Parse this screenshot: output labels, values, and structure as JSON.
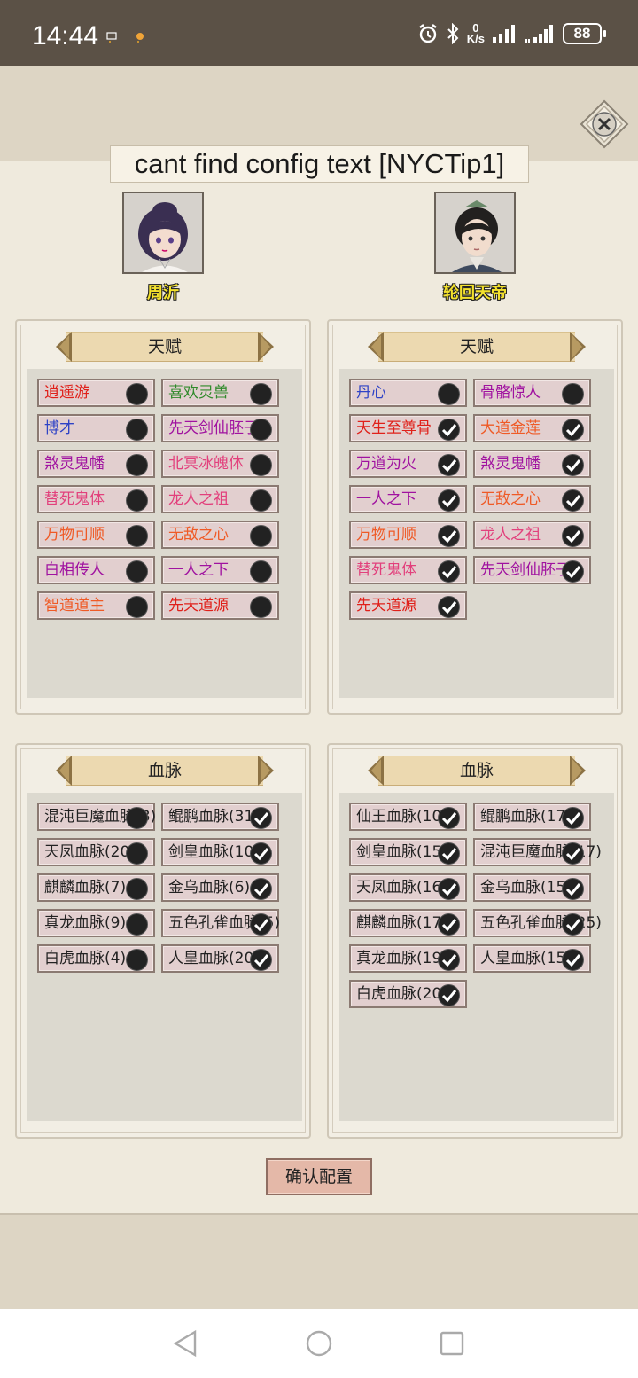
{
  "status_bar": {
    "time": "14:44",
    "net_speed_value": "0",
    "net_speed_unit": "K/s",
    "battery": "88"
  },
  "tip_text": "cant find config text [NYCTip1]",
  "characters": [
    {
      "name": "周沂"
    },
    {
      "name": "轮回天帝"
    }
  ],
  "panels": {
    "left_talent": {
      "title": "天赋",
      "items": [
        {
          "label": "逍遥游",
          "color": "#e0201a",
          "checked": false
        },
        {
          "label": "喜欢灵兽",
          "color": "#2f8a2a",
          "checked": false
        },
        {
          "label": "博才",
          "color": "#2f43c6",
          "checked": false
        },
        {
          "label": "先天剑仙胚子",
          "color": "#a012a0",
          "checked": false
        },
        {
          "label": "煞灵鬼幡",
          "color": "#a012a0",
          "checked": false
        },
        {
          "label": "北冥冰魄体",
          "color": "#e2407c",
          "checked": false
        },
        {
          "label": "替死鬼体",
          "color": "#e2407c",
          "checked": false
        },
        {
          "label": "龙人之祖",
          "color": "#e2407c",
          "checked": false
        },
        {
          "label": "万物可顺",
          "color": "#ef5a26",
          "checked": false
        },
        {
          "label": "无敌之心",
          "color": "#ef5a26",
          "checked": false
        },
        {
          "label": "白相传人",
          "color": "#a012a0",
          "checked": false
        },
        {
          "label": "一人之下",
          "color": "#a012a0",
          "checked": false
        },
        {
          "label": "智道道主",
          "color": "#ef5a26",
          "checked": false
        },
        {
          "label": "先天道源",
          "color": "#e0201a",
          "checked": false
        }
      ]
    },
    "right_talent": {
      "title": "天赋",
      "items": [
        {
          "label": "丹心",
          "color": "#2f43c6",
          "checked": false
        },
        {
          "label": "骨骼惊人",
          "color": "#a012a0",
          "checked": false
        },
        {
          "label": "天生至尊骨",
          "color": "#e0201a",
          "checked": true
        },
        {
          "label": "大道金莲",
          "color": "#ef5a26",
          "checked": true
        },
        {
          "label": "万道为火",
          "color": "#a012a0",
          "checked": true
        },
        {
          "label": "煞灵鬼幡",
          "color": "#a012a0",
          "checked": true
        },
        {
          "label": "一人之下",
          "color": "#a012a0",
          "checked": true
        },
        {
          "label": "无敌之心",
          "color": "#ef5a26",
          "checked": true
        },
        {
          "label": "万物可顺",
          "color": "#ef5a26",
          "checked": true
        },
        {
          "label": "龙人之祖",
          "color": "#e2407c",
          "checked": true
        },
        {
          "label": "替死鬼体",
          "color": "#e2407c",
          "checked": true
        },
        {
          "label": "先天剑仙胚子",
          "color": "#a012a0",
          "checked": true
        },
        {
          "label": "先天道源",
          "color": "#e0201a",
          "checked": true
        }
      ]
    },
    "left_bloodline": {
      "title": "血脉",
      "items": [
        {
          "label": "混沌巨魔血脉(8)",
          "color": "#222222",
          "checked": false
        },
        {
          "label": "鲲鹏血脉(31)",
          "color": "#222222",
          "checked": true
        },
        {
          "label": "天凤血脉(20)",
          "color": "#222222",
          "checked": false
        },
        {
          "label": "剑皇血脉(10)",
          "color": "#222222",
          "checked": true
        },
        {
          "label": "麒麟血脉(7)",
          "color": "#222222",
          "checked": false
        },
        {
          "label": "金乌血脉(6)",
          "color": "#222222",
          "checked": true
        },
        {
          "label": "真龙血脉(9)",
          "color": "#222222",
          "checked": false
        },
        {
          "label": "五色孔雀血脉(5)",
          "color": "#222222",
          "checked": true
        },
        {
          "label": "白虎血脉(4)",
          "color": "#222222",
          "checked": false
        },
        {
          "label": "人皇血脉(20)",
          "color": "#222222",
          "checked": true
        }
      ]
    },
    "right_bloodline": {
      "title": "血脉",
      "items": [
        {
          "label": "仙王血脉(10)",
          "color": "#222222",
          "checked": true
        },
        {
          "label": "鲲鹏血脉(17)",
          "color": "#222222",
          "checked": true
        },
        {
          "label": "剑皇血脉(15)",
          "color": "#222222",
          "checked": true
        },
        {
          "label": "混沌巨魔血脉(17)",
          "color": "#222222",
          "checked": true
        },
        {
          "label": "天凤血脉(16)",
          "color": "#222222",
          "checked": true
        },
        {
          "label": "金乌血脉(15)",
          "color": "#222222",
          "checked": true
        },
        {
          "label": "麒麟血脉(17)",
          "color": "#222222",
          "checked": true
        },
        {
          "label": "五色孔雀血脉(25)",
          "color": "#222222",
          "checked": true
        },
        {
          "label": "真龙血脉(19)",
          "color": "#222222",
          "checked": true
        },
        {
          "label": "人皇血脉(15)",
          "color": "#222222",
          "checked": true
        },
        {
          "label": "白虎血脉(20)",
          "color": "#222222",
          "checked": true
        }
      ]
    }
  },
  "confirm_label": "确认配置",
  "icons": {
    "close": "close-icon",
    "check": "checkmark-icon",
    "unchecked": "empty-circle-icon",
    "alarm": "alarm-icon",
    "bluetooth": "bluetooth-icon",
    "signal": "signal-icon",
    "nav_back": "back-triangle-icon",
    "nav_home": "home-circle-icon",
    "nav_recent": "recent-square-icon"
  }
}
